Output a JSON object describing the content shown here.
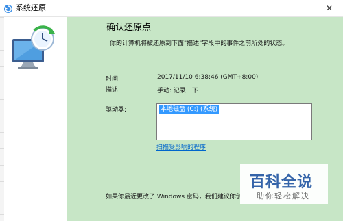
{
  "window": {
    "title": "系统还原",
    "close_glyph": "✕"
  },
  "content": {
    "heading": "确认还原点",
    "description": "你的计算机将被还原到下面\"描述\"字段中的事件之前所处的状态。",
    "time_label": "时间:",
    "time_value": "2017/11/10 6:38:46 (GMT+8:00)",
    "desc_label": "描述:",
    "desc_value": "手动: 记录一下",
    "drives_label": "驱动器:",
    "drives": [
      "本地磁盘 (C:) (系统)"
    ],
    "scan_link": "扫描受影响的程序",
    "bottom_note": "如果你最近更改了 Windows 密码，我们建议你创"
  },
  "watermark": {
    "main": "百科全说",
    "sub": "助你轻松解决"
  },
  "colors": {
    "main_bg": "#c7e6c6",
    "selection": "#3399ff",
    "link": "#0066cc",
    "watermark_text": "#2f5fa8"
  },
  "icons": {
    "title": "system-restore-icon",
    "hero": "system-restore-monitor-icon",
    "close": "close-icon"
  }
}
